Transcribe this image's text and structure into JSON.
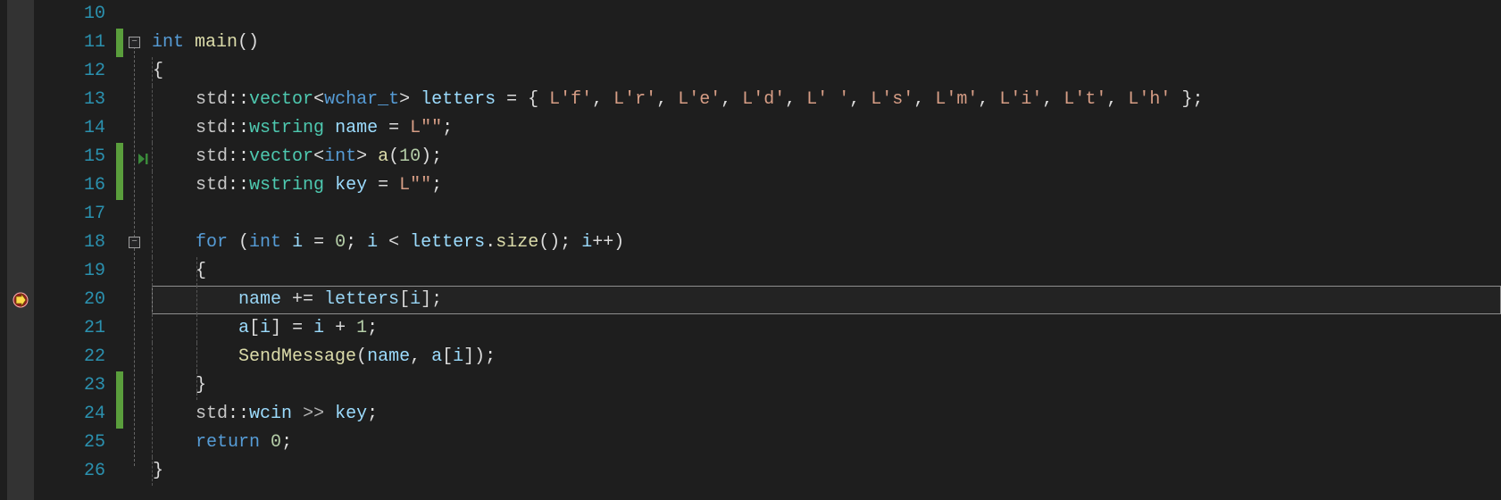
{
  "lineStart": 10,
  "lines": [
    {
      "num": 10,
      "tokens": []
    },
    {
      "num": 11,
      "tokens": [
        {
          "t": "int ",
          "c": "kw"
        },
        {
          "t": "main",
          "c": "fn"
        },
        {
          "t": "()",
          "c": "pun"
        }
      ]
    },
    {
      "num": 12,
      "tokens": [
        {
          "t": "{",
          "c": "pun"
        }
      ]
    },
    {
      "num": 13,
      "tokens": [
        {
          "t": "    ",
          "c": "white"
        },
        {
          "t": "std",
          "c": "ns"
        },
        {
          "t": "::",
          "c": "pun"
        },
        {
          "t": "vector",
          "c": "type"
        },
        {
          "t": "<",
          "c": "pun"
        },
        {
          "t": "wchar_t",
          "c": "tmpl"
        },
        {
          "t": "> ",
          "c": "pun"
        },
        {
          "t": "letters",
          "c": "var"
        },
        {
          "t": " = { ",
          "c": "pun"
        },
        {
          "t": "L'f'",
          "c": "str"
        },
        {
          "t": ", ",
          "c": "pun"
        },
        {
          "t": "L'r'",
          "c": "str"
        },
        {
          "t": ", ",
          "c": "pun"
        },
        {
          "t": "L'e'",
          "c": "str"
        },
        {
          "t": ", ",
          "c": "pun"
        },
        {
          "t": "L'd'",
          "c": "str"
        },
        {
          "t": ", ",
          "c": "pun"
        },
        {
          "t": "L' '",
          "c": "str"
        },
        {
          "t": ", ",
          "c": "pun"
        },
        {
          "t": "L's'",
          "c": "str"
        },
        {
          "t": ", ",
          "c": "pun"
        },
        {
          "t": "L'm'",
          "c": "str"
        },
        {
          "t": ", ",
          "c": "pun"
        },
        {
          "t": "L'i'",
          "c": "str"
        },
        {
          "t": ", ",
          "c": "pun"
        },
        {
          "t": "L't'",
          "c": "str"
        },
        {
          "t": ", ",
          "c": "pun"
        },
        {
          "t": "L'h'",
          "c": "str"
        },
        {
          "t": " };",
          "c": "pun"
        }
      ]
    },
    {
      "num": 14,
      "tokens": [
        {
          "t": "    ",
          "c": "white"
        },
        {
          "t": "std",
          "c": "ns"
        },
        {
          "t": "::",
          "c": "pun"
        },
        {
          "t": "wstring",
          "c": "type"
        },
        {
          "t": " ",
          "c": "pun"
        },
        {
          "t": "name",
          "c": "var"
        },
        {
          "t": " = ",
          "c": "pun"
        },
        {
          "t": "L\"\"",
          "c": "str"
        },
        {
          "t": ";",
          "c": "pun"
        }
      ]
    },
    {
      "num": 15,
      "tokens": [
        {
          "t": "    ",
          "c": "white"
        },
        {
          "t": "std",
          "c": "ns"
        },
        {
          "t": "::",
          "c": "pun"
        },
        {
          "t": "vector",
          "c": "type"
        },
        {
          "t": "<",
          "c": "pun"
        },
        {
          "t": "int",
          "c": "tmpl"
        },
        {
          "t": "> ",
          "c": "pun"
        },
        {
          "t": "a",
          "c": "fn"
        },
        {
          "t": "(",
          "c": "pun"
        },
        {
          "t": "10",
          "c": "num"
        },
        {
          "t": ");",
          "c": "pun"
        }
      ]
    },
    {
      "num": 16,
      "tokens": [
        {
          "t": "    ",
          "c": "white"
        },
        {
          "t": "std",
          "c": "ns"
        },
        {
          "t": "::",
          "c": "pun"
        },
        {
          "t": "wstring",
          "c": "type"
        },
        {
          "t": " ",
          "c": "pun"
        },
        {
          "t": "key",
          "c": "var"
        },
        {
          "t": " = ",
          "c": "pun"
        },
        {
          "t": "L\"\"",
          "c": "str"
        },
        {
          "t": ";",
          "c": "pun"
        }
      ]
    },
    {
      "num": 17,
      "tokens": []
    },
    {
      "num": 18,
      "tokens": [
        {
          "t": "    ",
          "c": "white"
        },
        {
          "t": "for",
          "c": "kw"
        },
        {
          "t": " (",
          "c": "pun"
        },
        {
          "t": "int",
          "c": "kw"
        },
        {
          "t": " ",
          "c": "pun"
        },
        {
          "t": "i",
          "c": "var"
        },
        {
          "t": " = ",
          "c": "pun"
        },
        {
          "t": "0",
          "c": "num"
        },
        {
          "t": "; ",
          "c": "pun"
        },
        {
          "t": "i",
          "c": "var"
        },
        {
          "t": " < ",
          "c": "pun"
        },
        {
          "t": "letters",
          "c": "var"
        },
        {
          "t": ".",
          "c": "pun"
        },
        {
          "t": "size",
          "c": "fn"
        },
        {
          "t": "(); ",
          "c": "pun"
        },
        {
          "t": "i",
          "c": "var"
        },
        {
          "t": "++)",
          "c": "pun"
        }
      ]
    },
    {
      "num": 19,
      "tokens": [
        {
          "t": "    {",
          "c": "pun"
        }
      ]
    },
    {
      "num": 20,
      "tokens": [
        {
          "t": "        ",
          "c": "white"
        },
        {
          "t": "name",
          "c": "var"
        },
        {
          "t": " += ",
          "c": "pun"
        },
        {
          "t": "letters",
          "c": "var"
        },
        {
          "t": "[",
          "c": "pun"
        },
        {
          "t": "i",
          "c": "var"
        },
        {
          "t": "];",
          "c": "pun"
        }
      ]
    },
    {
      "num": 21,
      "tokens": [
        {
          "t": "        ",
          "c": "white"
        },
        {
          "t": "a",
          "c": "var"
        },
        {
          "t": "[",
          "c": "pun"
        },
        {
          "t": "i",
          "c": "var"
        },
        {
          "t": "] = ",
          "c": "pun"
        },
        {
          "t": "i",
          "c": "var"
        },
        {
          "t": " + ",
          "c": "pun"
        },
        {
          "t": "1",
          "c": "num"
        },
        {
          "t": ";",
          "c": "pun"
        }
      ]
    },
    {
      "num": 22,
      "tokens": [
        {
          "t": "        ",
          "c": "white"
        },
        {
          "t": "SendMessage",
          "c": "fn"
        },
        {
          "t": "(",
          "c": "pun"
        },
        {
          "t": "name",
          "c": "var"
        },
        {
          "t": ", ",
          "c": "pun"
        },
        {
          "t": "a",
          "c": "var"
        },
        {
          "t": "[",
          "c": "pun"
        },
        {
          "t": "i",
          "c": "var"
        },
        {
          "t": "]);",
          "c": "pun"
        }
      ]
    },
    {
      "num": 23,
      "tokens": [
        {
          "t": "    }",
          "c": "pun"
        }
      ]
    },
    {
      "num": 24,
      "tokens": [
        {
          "t": "    ",
          "c": "white"
        },
        {
          "t": "std",
          "c": "ns"
        },
        {
          "t": "::",
          "c": "pun"
        },
        {
          "t": "wcin",
          "c": "var"
        },
        {
          "t": " >> ",
          "c": "op"
        },
        {
          "t": "key",
          "c": "var"
        },
        {
          "t": ";",
          "c": "pun"
        }
      ]
    },
    {
      "num": 25,
      "tokens": [
        {
          "t": "    ",
          "c": "white"
        },
        {
          "t": "return",
          "c": "kw"
        },
        {
          "t": " ",
          "c": "pun"
        },
        {
          "t": "0",
          "c": "num"
        },
        {
          "t": ";",
          "c": "pun"
        }
      ]
    },
    {
      "num": 26,
      "tokens": [
        {
          "t": "}",
          "c": "pun"
        }
      ]
    }
  ],
  "lineHeight": 32,
  "currentExecLine": 20,
  "foldMarkers": [
    {
      "line": 11,
      "glyph": "−"
    },
    {
      "line": 18,
      "glyph": "−"
    }
  ],
  "changeBars": [
    {
      "from": 11,
      "to": 11
    },
    {
      "from": 15,
      "to": 16
    },
    {
      "from": 23,
      "to": 24
    }
  ],
  "runToCursorLine": 15,
  "indentGuides": {
    "col1": {
      "from": 12,
      "to": 26,
      "offset": 0
    },
    "col2": {
      "from": 19,
      "to": 23,
      "offset": 50
    }
  }
}
